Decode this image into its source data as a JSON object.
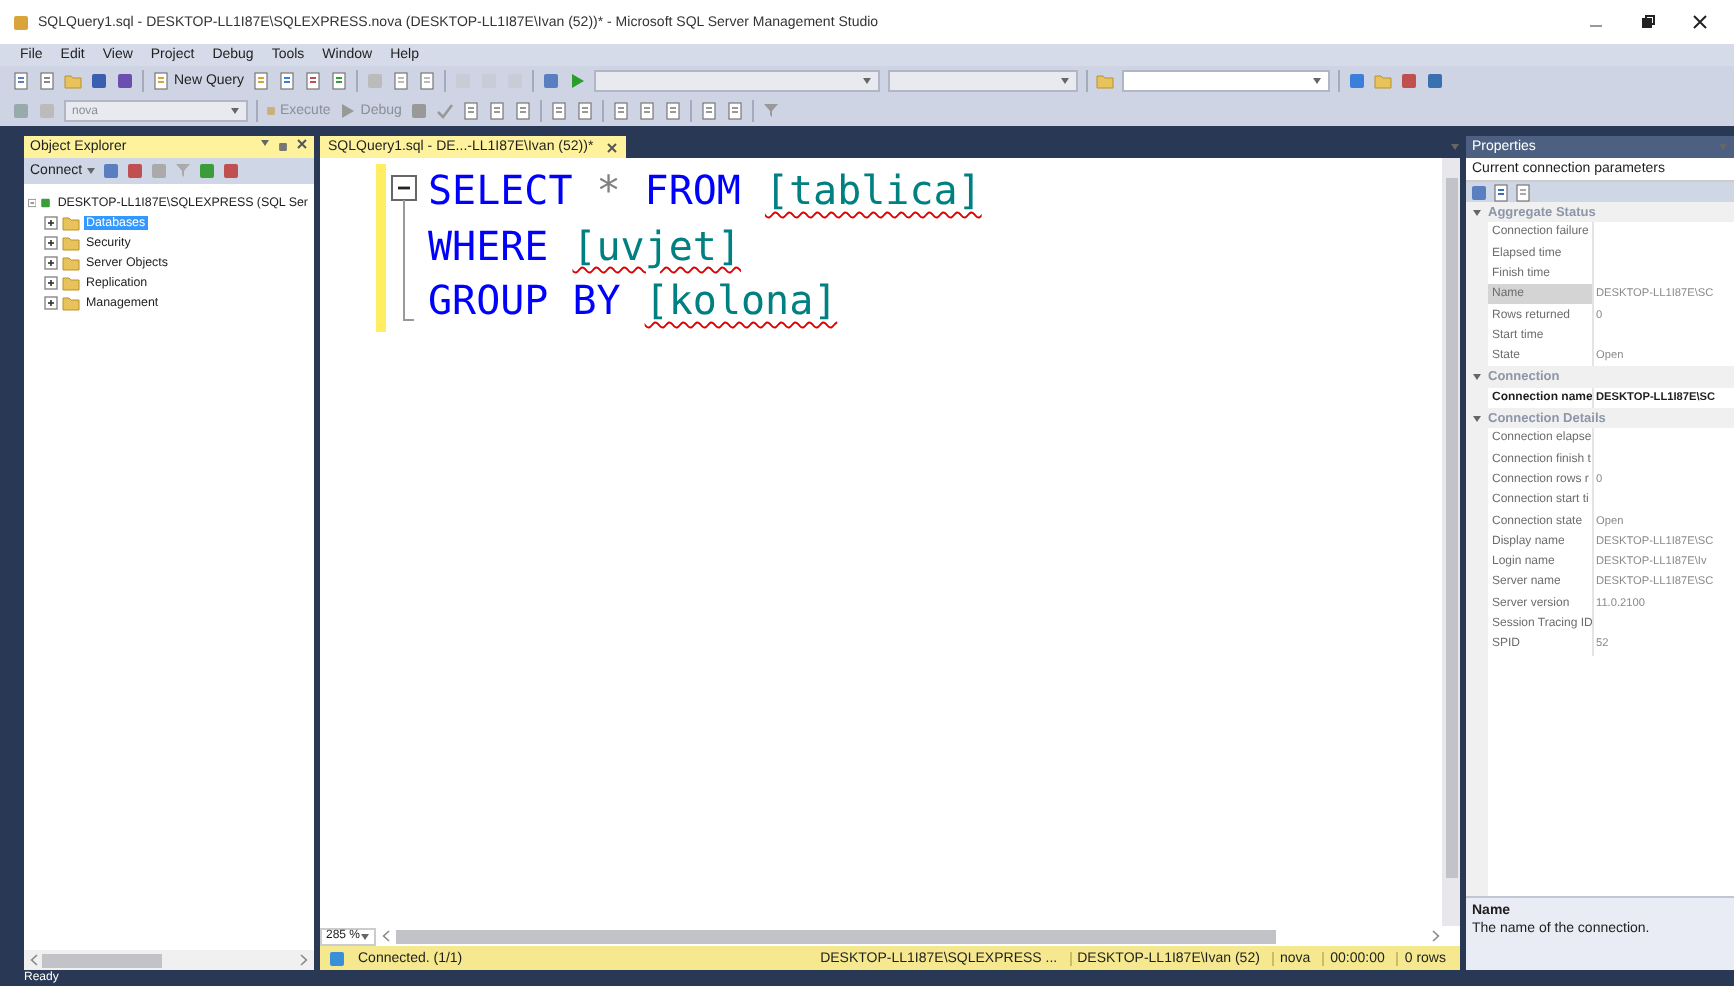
{
  "window": {
    "title": "SQLQuery1.sql - DESKTOP-LL1I87E\\SQLEXPRESS.nova (DESKTOP-LL1I87E\\Ivan (52))* - Microsoft SQL Server Management Studio"
  },
  "menu": [
    "File",
    "Edit",
    "View",
    "Project",
    "Debug",
    "Tools",
    "Window",
    "Help"
  ],
  "toolbar": {
    "new_query": "New Query",
    "database": "nova",
    "execute": "Execute",
    "debug": "Debug"
  },
  "object_explorer": {
    "title": "Object Explorer",
    "connect": "Connect",
    "tree": [
      {
        "label": "DESKTOP-LL1I87E\\SQLEXPRESS (SQL Ser",
        "expanded": true,
        "selected": false,
        "children": [
          {
            "label": "Databases",
            "expanded": false,
            "selected": true
          },
          {
            "label": "Security",
            "expanded": false,
            "selected": false
          },
          {
            "label": "Server Objects",
            "expanded": false,
            "selected": false
          },
          {
            "label": "Replication",
            "expanded": false,
            "selected": false
          },
          {
            "label": "Management",
            "expanded": false,
            "selected": false
          }
        ]
      }
    ]
  },
  "editor": {
    "tab": "SQLQuery1.sql - DE...-LL1I87E\\Ivan (52))*",
    "zoom": "285 %",
    "lines": [
      [
        {
          "kind": "keyword",
          "text": "SELECT"
        },
        {
          "kind": "operator",
          "text": "*"
        },
        {
          "kind": "keyword",
          "text": "FROM"
        },
        {
          "kind": "identifier",
          "text": "[tablica]",
          "error": true
        }
      ],
      [
        {
          "kind": "keyword",
          "text": "WHERE"
        },
        {
          "kind": "identifier",
          "text": "[uvjet]",
          "error": true
        }
      ],
      [
        {
          "kind": "keyword",
          "text": "GROUP BY"
        },
        {
          "kind": "identifier",
          "text": "[kolona]",
          "error": true
        }
      ]
    ]
  },
  "query_status": {
    "message": "Connected. (1/1)",
    "server": "DESKTOP-LL1I87E\\SQLEXPRESS ...",
    "user": "DESKTOP-LL1I87E\\Ivan (52)",
    "database": "nova",
    "elapsed": "00:00:00",
    "rows": "0 rows"
  },
  "properties": {
    "title": "Properties",
    "object": "Current connection parameters",
    "rows": [
      {
        "kind": "category",
        "name": "Aggregate Status",
        "expanded": true
      },
      {
        "kind": "property",
        "name": "Connection failure",
        "value": "",
        "selected": false,
        "bold": false
      },
      {
        "kind": "property",
        "name": "Elapsed time",
        "value": "",
        "selected": false,
        "bold": false
      },
      {
        "kind": "property",
        "name": "Finish time",
        "value": "",
        "selected": false,
        "bold": false
      },
      {
        "kind": "property",
        "name": "Name",
        "value": "DESKTOP-LL1I87E\\SC",
        "selected": true,
        "bold": false
      },
      {
        "kind": "property",
        "name": "Rows returned",
        "value": "0",
        "selected": false,
        "bold": false
      },
      {
        "kind": "property",
        "name": "Start time",
        "value": "",
        "selected": false,
        "bold": false
      },
      {
        "kind": "property",
        "name": "State",
        "value": "Open",
        "selected": false,
        "bold": false
      },
      {
        "kind": "category",
        "name": "Connection",
        "expanded": true
      },
      {
        "kind": "property",
        "name": "Connection name",
        "value": "DESKTOP-LL1I87E\\SC",
        "selected": false,
        "bold": true
      },
      {
        "kind": "category",
        "name": "Connection Details",
        "expanded": true
      },
      {
        "kind": "property",
        "name": "Connection elapse",
        "value": "",
        "selected": false,
        "bold": false
      },
      {
        "kind": "property",
        "name": "Connection finish t",
        "value": "",
        "selected": false,
        "bold": false
      },
      {
        "kind": "property",
        "name": "Connection rows r",
        "value": "0",
        "selected": false,
        "bold": false
      },
      {
        "kind": "property",
        "name": "Connection start ti",
        "value": "",
        "selected": false,
        "bold": false
      },
      {
        "kind": "property",
        "name": "Connection state",
        "value": "Open",
        "selected": false,
        "bold": false
      },
      {
        "kind": "property",
        "name": "Display name",
        "value": "DESKTOP-LL1I87E\\SC",
        "selected": false,
        "bold": false
      },
      {
        "kind": "property",
        "name": "Login name",
        "value": "DESKTOP-LL1I87E\\Iv",
        "selected": false,
        "bold": false
      },
      {
        "kind": "property",
        "name": "Server name",
        "value": "DESKTOP-LL1I87E\\SC",
        "selected": false,
        "bold": false
      },
      {
        "kind": "property",
        "name": "Server version",
        "value": "11.0.2100",
        "selected": false,
        "bold": false
      },
      {
        "kind": "property",
        "name": "Session Tracing ID",
        "value": "",
        "selected": false,
        "bold": false
      },
      {
        "kind": "property",
        "name": "SPID",
        "value": "52",
        "selected": false,
        "bold": false
      }
    ],
    "description_title": "Name",
    "description": "The name of the connection."
  },
  "status_bar": "Ready"
}
